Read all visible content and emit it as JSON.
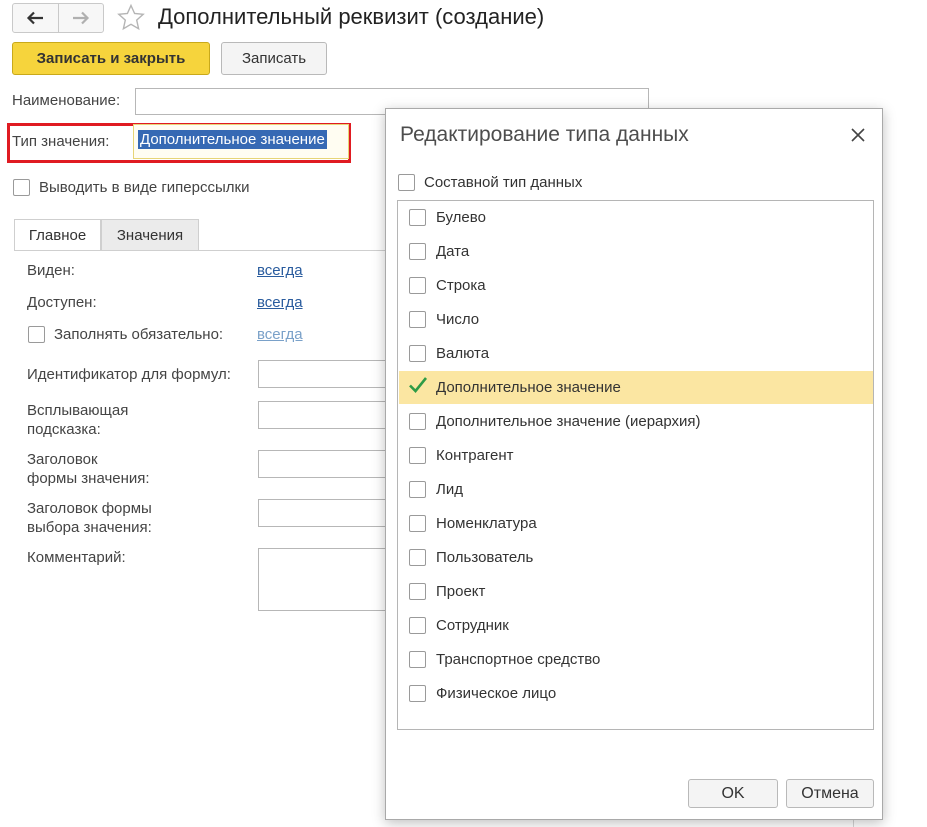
{
  "window": {
    "title": "Дополнительный реквизит (создание)"
  },
  "toolbar": {
    "save_close_label": "Записать и закрыть",
    "save_label": "Записать"
  },
  "form": {
    "name_label": "Наименование:",
    "name_value": "",
    "type_label": "Тип значения:",
    "type_value": "Дополнительное значение",
    "hyperlink_label": "Выводить в виде гиперссылки"
  },
  "tabs": [
    {
      "label": "Главное"
    },
    {
      "label": "Значения"
    }
  ],
  "main": {
    "visible_label": "Виден:",
    "visible_value": "всегда",
    "available_label": "Доступен:",
    "available_value": "всегда",
    "required_label": "Заполнять обязательно:",
    "required_value": "всегда",
    "identifier_label": "Идентификатор для формул:",
    "tooltip_label_1": "Всплывающая",
    "tooltip_label_2": "подсказка:",
    "value_form_label_1": "Заголовок",
    "value_form_label_2": "формы значения:",
    "choice_form_label_1": "Заголовок формы",
    "choice_form_label_2": "выбора значения:",
    "comment_label": "Комментарий:"
  },
  "dialog": {
    "title": "Редактирование типа данных",
    "composite_label": "Составной тип данных",
    "composite_checked": false,
    "items": [
      {
        "label": "Булево",
        "checked": false
      },
      {
        "label": "Дата",
        "checked": false
      },
      {
        "label": "Строка",
        "checked": false
      },
      {
        "label": "Число",
        "checked": false
      },
      {
        "label": "Валюта",
        "checked": false
      },
      {
        "label": "Дополнительное значение",
        "checked": true
      },
      {
        "label": "Дополнительное значение (иерархия)",
        "checked": false
      },
      {
        "label": "Контрагент",
        "checked": false
      },
      {
        "label": "Лид",
        "checked": false
      },
      {
        "label": "Номенклатура",
        "checked": false
      },
      {
        "label": "Пользователь",
        "checked": false
      },
      {
        "label": "Проект",
        "checked": false
      },
      {
        "label": "Сотрудник",
        "checked": false
      },
      {
        "label": "Транспортное средство",
        "checked": false
      },
      {
        "label": "Физическое лицо",
        "checked": false
      }
    ],
    "ok_label": "OK",
    "cancel_label": "Отмена"
  },
  "colors": {
    "primary_button": "#f6d43c",
    "selection": "#3669b4",
    "highlight_row": "#fbe6a2",
    "check": "#2e9b46",
    "link": "#2a5c9e",
    "red_frame": "#e01b22"
  },
  "icons": [
    "back-arrow-icon",
    "forward-arrow-icon",
    "star-icon",
    "close-icon",
    "checkmark-icon"
  ]
}
